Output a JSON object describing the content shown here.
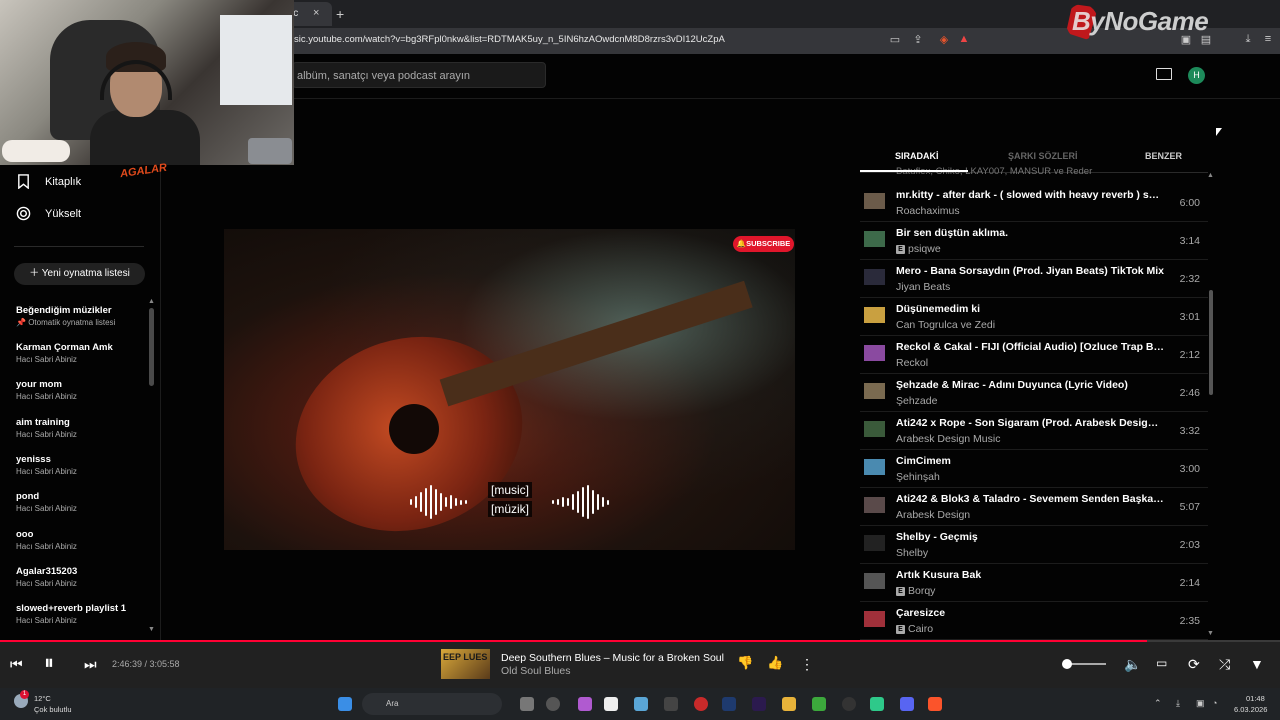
{
  "browser": {
    "tab_label": "sic",
    "tab_close": "×",
    "new_tab": "+",
    "url": "sic.youtube.com/watch?v=bg3RFpl0nkw&list=RDTMAK5uy_n_5IN6hzAOwdcnM8D8rzrs3vDI12UcZpA"
  },
  "header": {
    "search_placeholder": "albüm, sanatçı veya podcast arayın",
    "avatar_letter": "H"
  },
  "webcam": {
    "overlay_text": "AGALAR"
  },
  "watermark": {
    "logo": "ByNoGame"
  },
  "sidebar": {
    "nav": [
      {
        "label": "Kitaplık",
        "icon": "bookmark-icon"
      },
      {
        "label": "Yükselt",
        "icon": "upgrade-icon"
      }
    ],
    "new_playlist": "Yeni oynatma listesi",
    "playlists": [
      {
        "title": "Beğendiğim müzikler",
        "subtitle": "Otomatik oynatma listesi"
      },
      {
        "title": "Karman Çorman Amk",
        "subtitle": "Hacı Sabri Abiniz"
      },
      {
        "title": "your mom",
        "subtitle": "Hacı Sabri Abiniz"
      },
      {
        "title": "aim training",
        "subtitle": "Hacı Sabri Abiniz"
      },
      {
        "title": "yenisss",
        "subtitle": "Hacı Sabri Abiniz"
      },
      {
        "title": "pond",
        "subtitle": "Hacı Sabri Abiniz"
      },
      {
        "title": "ooo",
        "subtitle": "Hacı Sabri Abiniz"
      },
      {
        "title": "Agalar315203",
        "subtitle": "Hacı Sabri Abiniz"
      },
      {
        "title": "slowed+reverb playlist 1",
        "subtitle": "Hacı Sabri Abiniz"
      }
    ]
  },
  "video": {
    "subscribe_label": "SUBSCRIBE",
    "caption_line1": "[music]",
    "caption_line2": "[müzik]"
  },
  "queue": {
    "tabs": [
      "SIRADAKİ",
      "ŞARKI SÖZLERİ",
      "BENZER"
    ],
    "partial_row": "Batuflex, Chiko, LKAY007, MANSUR ve Reder",
    "items": [
      {
        "title": "mr.kitty - after dark - ( slowed with heavy reverb ) sad ...",
        "artist": "Roachaximus",
        "duration": "6:00",
        "explicit": false,
        "thumb_color": "#6b5b4a"
      },
      {
        "title": "Bir sen düştün aklıma.",
        "artist": "psiqwe",
        "duration": "3:14",
        "explicit": true,
        "thumb_color": "#3d6a4a"
      },
      {
        "title": "Mero - Bana Sorsaydın (Prod. Jiyan Beats) TikTok Mix",
        "artist": "Jiyan Beats",
        "duration": "2:32",
        "explicit": false,
        "thumb_color": "#2a2a3a"
      },
      {
        "title": "Düşünemedim ki",
        "artist": "Can Togrulca ve Zedi",
        "duration": "3:01",
        "explicit": false,
        "thumb_color": "#c9a040"
      },
      {
        "title": "Reckol & Cakal - FIJI (Official Audio) [Ozluce Trap Boy...",
        "artist": "Reckol",
        "duration": "2:12",
        "explicit": false,
        "thumb_color": "#8a4aa0"
      },
      {
        "title": "Şehzade & Mirac - Adını Duyunca (Lyric Video)",
        "artist": "Şehzade",
        "duration": "2:46",
        "explicit": false,
        "thumb_color": "#7a6a50"
      },
      {
        "title": "Ati242 x Rope - Son Sigaram (Prod. Arabesk Design M...",
        "artist": "Arabesk Design Music",
        "duration": "3:32",
        "explicit": false,
        "thumb_color": "#3a5a3a"
      },
      {
        "title": "CimCimem",
        "artist": "Şehinşah",
        "duration": "3:00",
        "explicit": false,
        "thumb_color": "#4a8ab0"
      },
      {
        "title": "Ati242 & Blok3 & Taladro - Sevemem Senden Başka Bi...",
        "artist": "Arabesk Design",
        "duration": "5:07",
        "explicit": false,
        "thumb_color": "#5a4a4a"
      },
      {
        "title": "Shelby - Geçmiş",
        "artist": "Shelby",
        "duration": "2:03",
        "explicit": false,
        "thumb_color": "#222222"
      },
      {
        "title": "Artık Kusura Bak",
        "artist": "Borqy",
        "duration": "2:14",
        "explicit": true,
        "thumb_color": "#555555"
      },
      {
        "title": "Çaresizce",
        "artist": "Cairo",
        "duration": "2:35",
        "explicit": true,
        "thumb_color": "#a0303a"
      }
    ]
  },
  "player": {
    "time": "2:46:39 / 3:05:58",
    "progress_fraction": 0.896,
    "title": "Deep Southern Blues – Music for a Broken Soul",
    "artist": "Old Soul Blues",
    "thumb_text": "EEP LUES",
    "volume_fraction": 0.05
  },
  "taskbar": {
    "temperature": "12°C",
    "weather": "Çok bulutlu",
    "weather_badge": "1",
    "search": "Ara",
    "time": "01:48",
    "date": "6.03.2026"
  },
  "colors": {
    "accent": "#ff0033",
    "background": "#030303",
    "player_bg": "#212121"
  }
}
